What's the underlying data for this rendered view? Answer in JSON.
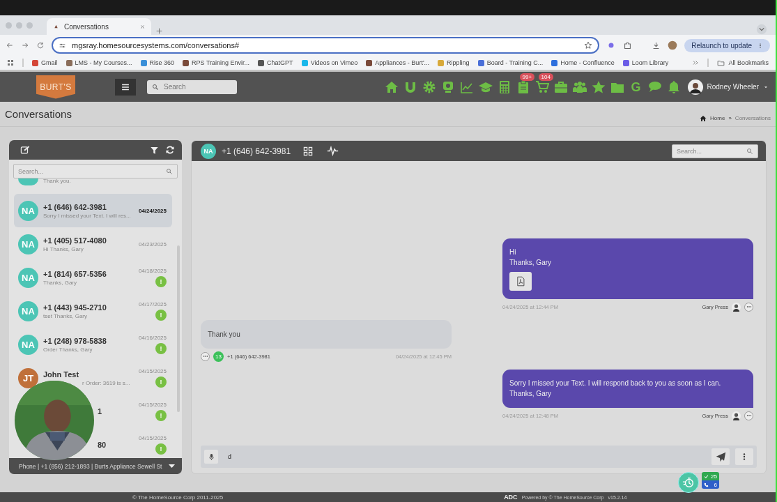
{
  "browser": {
    "tab": {
      "title": "Conversations"
    },
    "url": "mgsray.homesourcesystems.com/conversations#",
    "relaunch": "Relaunch to update",
    "bookmarks": [
      {
        "label": "Gmail",
        "color": "#d44638"
      },
      {
        "label": "LMS - My Courses...",
        "color": "#8a6d5a"
      },
      {
        "label": "Rise 360",
        "color": "#3a8fd8"
      },
      {
        "label": "RPS Training Envir...",
        "color": "#7a4a3a"
      },
      {
        "label": "ChatGPT",
        "color": "#555555"
      },
      {
        "label": "Videos on Vimeo",
        "color": "#1ab7ea"
      },
      {
        "label": "Appliances - Burt'...",
        "color": "#7a4a3a"
      },
      {
        "label": "Rippling",
        "color": "#d8a93a"
      },
      {
        "label": "Board - Training C...",
        "color": "#4a6fd8"
      },
      {
        "label": "Home - Confluence",
        "color": "#2d6fdd"
      },
      {
        "label": "Loom Library",
        "color": "#6b5ce7"
      }
    ],
    "all_bookmarks": "All Bookmarks"
  },
  "nav": {
    "logo": "BURT'S",
    "search": {
      "placeholder": "Search"
    },
    "tools": [
      {
        "kind": "home"
      },
      {
        "kind": "magnet"
      },
      {
        "kind": "gear"
      },
      {
        "kind": "monitor"
      },
      {
        "kind": "chart"
      },
      {
        "kind": "cap"
      },
      {
        "kind": "calculator"
      },
      {
        "kind": "clipboard",
        "badge": "99+"
      },
      {
        "kind": "cart",
        "badge": "104"
      },
      {
        "kind": "briefcase"
      },
      {
        "kind": "people"
      },
      {
        "kind": "star"
      },
      {
        "kind": "folder"
      },
      {
        "kind": "letter",
        "label": "G"
      },
      {
        "kind": "chat"
      },
      {
        "kind": "bell"
      }
    ],
    "user": "Rodney Wheeler"
  },
  "page": {
    "title": "Conversations",
    "breadcrumb": [
      "Home",
      "Conversations"
    ],
    "breadcrumb_separator": "»"
  },
  "conversations": {
    "search": {
      "placeholder": "Search..."
    },
    "items": [
      {
        "kind": "clipped",
        "color": "#4cc5b5",
        "preview": "Thank you.",
        "selected": false
      },
      {
        "kind": "full",
        "color": "#4cc5b5",
        "initials": "NA",
        "name": "+1 (646) 642-3981",
        "preview": "Sorry I missed your Text. I will res...",
        "date": "04/24/2025",
        "selected": true
      },
      {
        "kind": "full",
        "color": "#4cc5b5",
        "initials": "NA",
        "name": "+1 (405) 517-4080",
        "preview": "Hi Thanks, Gary",
        "date": "04/23/2025",
        "selected": false
      },
      {
        "kind": "full",
        "color": "#4cc5b5",
        "initials": "NA",
        "name": "+1 (814) 657-5356",
        "preview": "Thanks, Gary",
        "date": "04/18/2025",
        "alert": "!",
        "selected": false
      },
      {
        "kind": "full",
        "color": "#4cc5b5",
        "initials": "NA",
        "name": "+1 (443) 945-2710",
        "preview": "tset Thanks, Gary",
        "date": "04/17/2025",
        "alert": "!",
        "selected": false
      },
      {
        "kind": "full",
        "color": "#4cc5b5",
        "initials": "NA",
        "name": "+1 (248) 978-5838",
        "preview": "Order Thanks, Gary",
        "date": "04/16/2025",
        "alert": "!",
        "selected": false
      },
      {
        "kind": "covered",
        "color": "#c0703a",
        "initials": "JT",
        "name": "John Test",
        "preview": "r Order: 3619 is s...",
        "date": "04/15/2025",
        "alert": "!",
        "selected": false
      },
      {
        "kind": "covered",
        "name": "1",
        "date": "04/15/2025",
        "alert": "!",
        "selected": false
      },
      {
        "kind": "covered",
        "name": "80",
        "date": "04/15/2025",
        "alert": "!",
        "selected": false
      }
    ],
    "phone_line": "Phone | +1 (856) 212-1893 | Burts Appliance Sewell St"
  },
  "chat": {
    "initials": "NA",
    "number": "+1 (646) 642-3981",
    "search": {
      "placeholder": "Search..."
    },
    "messages": [
      {
        "kind": "outgoing",
        "text": "Hi\nThanks, Gary",
        "attachment": true,
        "time": "04/24/2025 at 12:44 PM",
        "sender": "Gary Press"
      },
      {
        "kind": "incoming",
        "text": "Thank you",
        "count": "13",
        "from": "+1 (646) 642-3981",
        "time": "04/24/2025 at 12:45 PM"
      },
      {
        "kind": "outgoing",
        "text": "Sorry I missed your Text. I will respond back to you as soon as I can.\nThanks, Gary",
        "time": "04/24/2025 at 12:48 PM",
        "sender": "Gary Press"
      }
    ],
    "composer": {
      "value": "d"
    }
  },
  "widget": {
    "done": "25",
    "calls": "6"
  },
  "footer": {
    "copyright": "© The HomeSource Corp 2011-2025",
    "brand": "ADC",
    "powered": "Powered by © The HomeSource Corp",
    "version": "v15.2.14"
  }
}
